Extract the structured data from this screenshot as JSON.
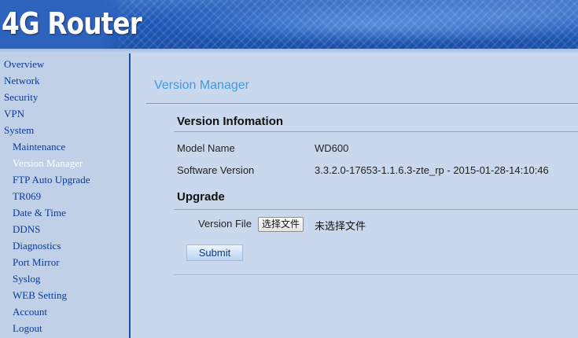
{
  "header": {
    "logo_text": "4G Router"
  },
  "sidebar": {
    "items": [
      {
        "label": "Overview",
        "level": "top",
        "active": false
      },
      {
        "label": "Network",
        "level": "top",
        "active": false
      },
      {
        "label": "Security",
        "level": "top",
        "active": false
      },
      {
        "label": "VPN",
        "level": "top",
        "active": false
      },
      {
        "label": "System",
        "level": "top",
        "active": false
      },
      {
        "label": "Maintenance",
        "level": "sub",
        "active": false
      },
      {
        "label": "Version Manager",
        "level": "sub",
        "active": true
      },
      {
        "label": "FTP Auto Upgrade",
        "level": "sub",
        "active": false
      },
      {
        "label": "TR069",
        "level": "sub",
        "active": false
      },
      {
        "label": "Date & Time",
        "level": "sub",
        "active": false
      },
      {
        "label": "DDNS",
        "level": "sub",
        "active": false
      },
      {
        "label": "Diagnostics",
        "level": "sub",
        "active": false
      },
      {
        "label": "Port Mirror",
        "level": "sub",
        "active": false
      },
      {
        "label": "Syslog",
        "level": "sub",
        "active": false
      },
      {
        "label": "WEB Setting",
        "level": "sub",
        "active": false
      },
      {
        "label": "Account",
        "level": "sub",
        "active": false
      },
      {
        "label": "Logout",
        "level": "sub",
        "active": false
      }
    ]
  },
  "main": {
    "page_title": "Version Manager",
    "version_info": {
      "title": "Version Infomation",
      "model_name_label": "Model Name",
      "model_name_value": "WD600",
      "software_version_label": "Software Version",
      "software_version_value": "3.3.2.0-17653-1.1.6.3-zte_rp - 2015-01-28-14:10:46"
    },
    "upgrade": {
      "title": "Upgrade",
      "file_label": "Version File",
      "choose_file_button": "选择文件",
      "file_status": "未选择文件",
      "submit_label": "Submit"
    }
  },
  "colors": {
    "header_blue": "#1e58b8",
    "sidebar_bg": "#bfd0e7",
    "main_bg": "#c9d8ec",
    "nav_link": "#0b3a9a",
    "page_title": "#3f9ae0"
  }
}
